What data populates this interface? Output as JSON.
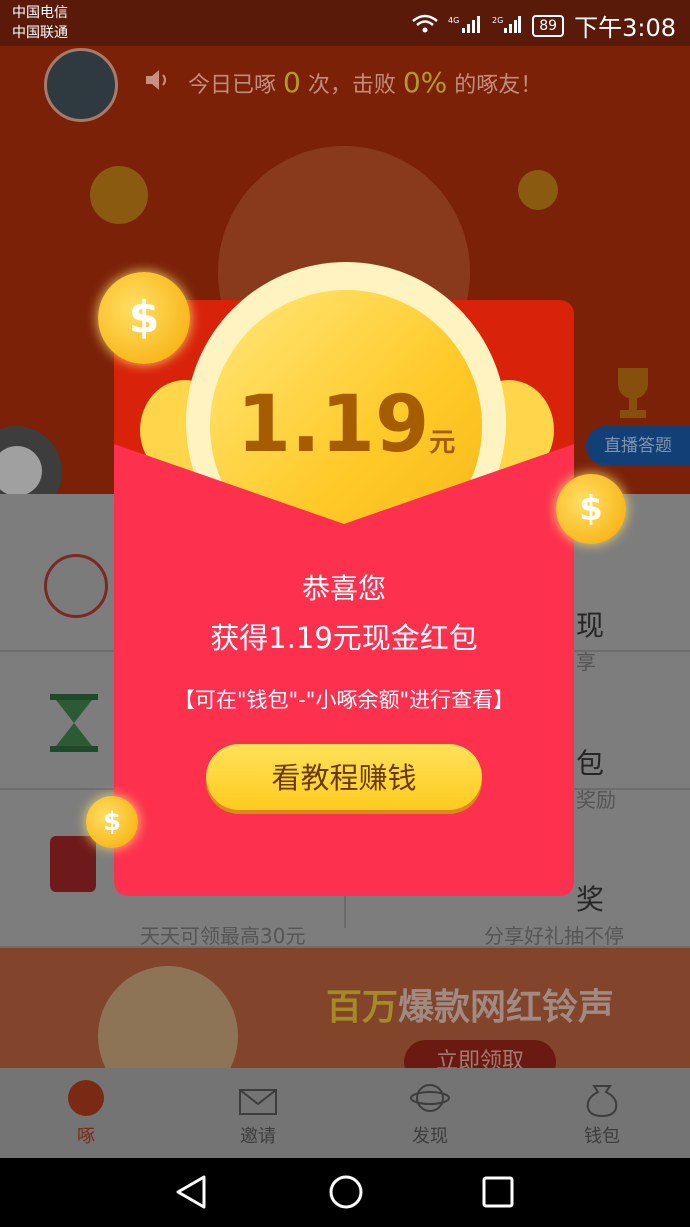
{
  "status_bar": {
    "carrier1": "中国电信",
    "carrier2": "中国联通",
    "battery": "89",
    "time": "下午3:08"
  },
  "header": {
    "stat_prefix": "今日已啄",
    "count": "0",
    "stat_mid": "次，击败",
    "percent": "0%",
    "stat_suffix": "的啄友！"
  },
  "live_quiz_label": "直播答题",
  "menu_peek": {
    "r1_right_title": "现",
    "r1_right_sub": "享",
    "r2_right_title": "包",
    "r2_right_sub": "奖励",
    "r3_right_title": "奖",
    "r3_left_sub": "天天可领最高30元",
    "r3_right_sub": "分享好礼抽不停"
  },
  "banner": {
    "title_a": "百万",
    "title_b": "爆款网红铃声",
    "button": "立即领取"
  },
  "tabs": [
    {
      "label": "啄"
    },
    {
      "label": "邀请"
    },
    {
      "label": "发现"
    },
    {
      "label": "钱包"
    }
  ],
  "popup": {
    "amount": "1.19",
    "unit": "元",
    "congrats": "恭喜您",
    "message": "获得1.19元现金红包",
    "note": "【可在\"钱包\"-\"小啄余额\"进行查看】",
    "cta": "看教程赚钱"
  },
  "colors": {
    "accent_yellow": "#ffcb1e",
    "envelope_red": "#fd304e",
    "envelope_top": "#d8220a"
  }
}
